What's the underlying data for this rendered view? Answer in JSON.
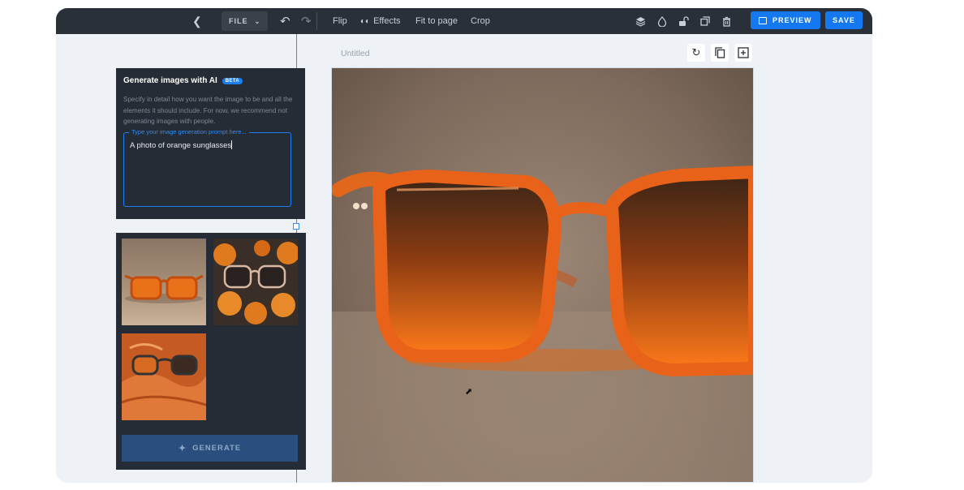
{
  "toolbar": {
    "back_icon": "chevron-left-icon",
    "file_label": "FILE",
    "undo_icon": "undo-icon",
    "redo_icon": "redo-icon",
    "flip_label": "Flip",
    "effects_label": "Effects",
    "fit_label": "Fit to page",
    "crop_label": "Crop",
    "right_icons": [
      "layers-icon",
      "fill-drop-icon",
      "unlock-icon",
      "duplicate-icon",
      "trash-icon"
    ],
    "preview_label": "PREVIEW",
    "save_label": "SAVE"
  },
  "ai_panel": {
    "title": "Generate images with AI",
    "badge": "BETA",
    "description": "Specify in detail how you want the image to be and all the elements it should include. For now, we recommend not generating images with people.",
    "prompt_placeholder": "Type your image generation prompt here...",
    "prompt_value": "A photo of orange sunglasses"
  },
  "results": {
    "thumbnails": [
      "orange-sunglasses-thumb-1",
      "orange-sunglasses-with-pumpkins-thumb",
      "orange-sunglasses-on-fabric-thumb"
    ],
    "generate_label": "GENERATE"
  },
  "canvas": {
    "title": "Untitled",
    "tools": [
      "reset-icon",
      "copy-icon",
      "add-page-icon"
    ]
  },
  "colors": {
    "toolbar_bg": "#2a3038",
    "accent": "#1478f0",
    "panel_bg": "#262c35",
    "app_bg": "#eef2f7"
  }
}
